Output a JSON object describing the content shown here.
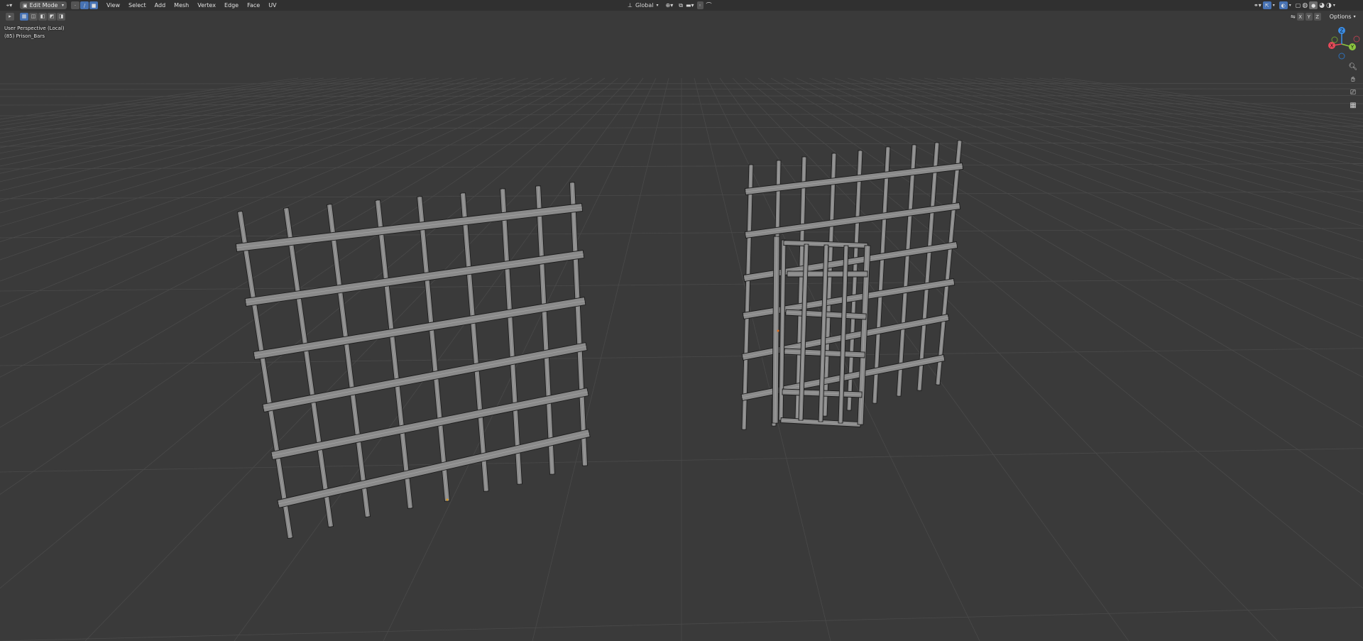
{
  "header": {
    "editor_icon": "viewport-3d-icon",
    "mode_label": "Edit Mode",
    "menus": [
      "View",
      "Select",
      "Add",
      "Mesh",
      "Vertex",
      "Edge",
      "Face",
      "UV"
    ],
    "transform_orientation": "Global",
    "options_label": "Options",
    "xyz_labels": [
      "X",
      "Y",
      "Z"
    ]
  },
  "overlay": {
    "view_name": "User Perspective (Local)",
    "object_name": "(85) Prison_Bars"
  },
  "gizmo": {
    "axes": [
      "X",
      "Y",
      "Z"
    ],
    "colors": {
      "x": "#e84a5a",
      "y": "#8cc63f",
      "z": "#3b8ee8"
    }
  },
  "colors": {
    "background": "#3a3a3a",
    "grid": "#4a4a4a",
    "mesh_face": "#8a8a8a",
    "mesh_edge": "#1c1c1c",
    "header": "#303030",
    "accent": "#4772b3"
  }
}
